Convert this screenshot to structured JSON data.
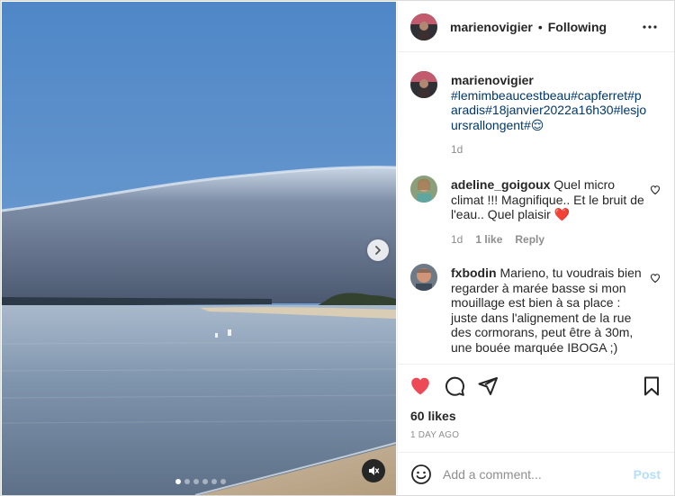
{
  "post": {
    "author": "marienovigier",
    "follow_separator": "•",
    "follow_state": "Following",
    "more_icon": "more-horizontal-icon",
    "media": {
      "slide_count": 6,
      "active_slide": 1,
      "next_icon": "chevron-right-icon",
      "mute_icon": "muted-speaker-icon"
    },
    "caption": {
      "user": "marienovigier",
      "text": "#lemimbeaucestbeau#capferret#paradis#18janvier2022a16h30#lesjoursrallongent#😌",
      "time": "1d"
    },
    "comments": [
      {
        "user": "adeline_goigoux",
        "text": "Quel micro climat !!! Magnifique.. Et le bruit de l'eau.. Quel plaisir ❤️",
        "time": "1d",
        "likes": "1 like",
        "reply": "Reply"
      },
      {
        "user": "fxbodin",
        "text": "Marieno, tu voudrais bien regarder à marée basse si mon mouillage est bien à sa place : juste dans l'alignement de la rue des cormorans, peut être à 30m, une bouée marquée IBOGA ;)"
      }
    ],
    "actions": {
      "like_icon": "heart-filled-icon",
      "comment_icon": "comment-icon",
      "share_icon": "paper-plane-icon",
      "save_icon": "bookmark-icon"
    },
    "likes": "60 likes",
    "time_ago": "1 DAY AGO",
    "add_comment": {
      "placeholder": "Add a comment...",
      "post_label": "Post",
      "emoji_icon": "smiley-icon"
    }
  },
  "colors": {
    "like_red": "#ed4956",
    "hashtag_blue": "#00376b",
    "muted_text": "#8e8e8e",
    "post_disabled": "#b2dffc"
  }
}
